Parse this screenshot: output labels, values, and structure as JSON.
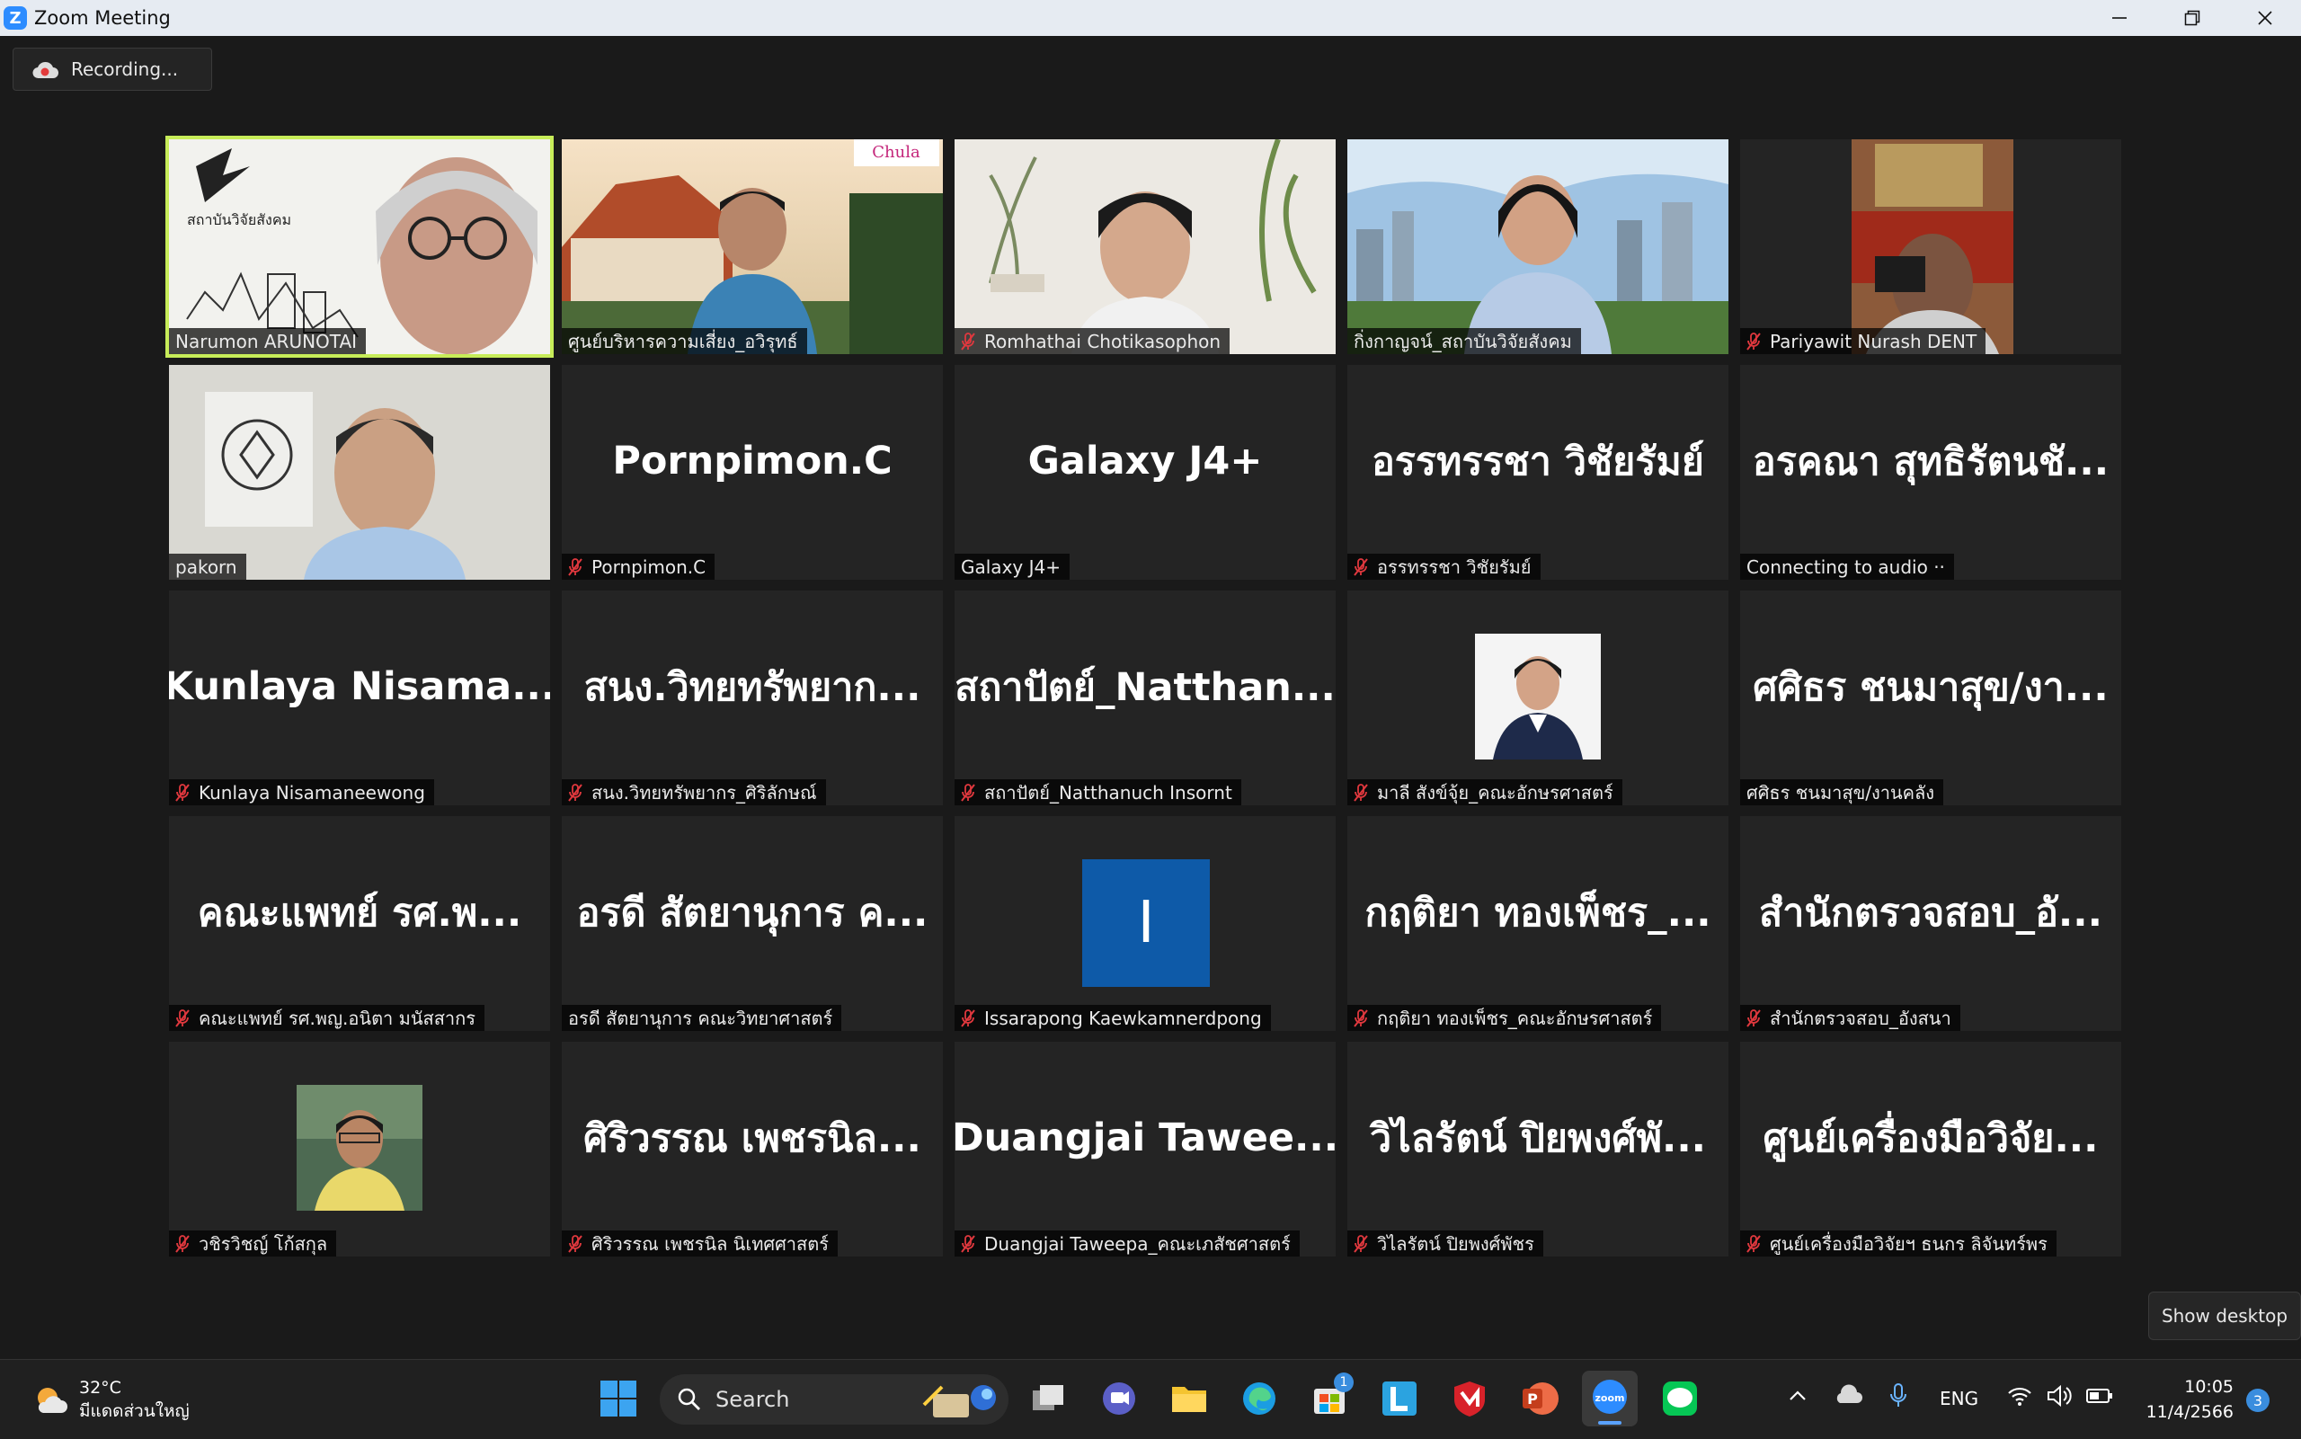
{
  "window": {
    "title": "Zoom Meeting"
  },
  "recording": {
    "label": "Recording..."
  },
  "show_desktop": "Show desktop",
  "participants": [
    {
      "big": "",
      "name": "Narumon ARUNOTAI",
      "muted": false,
      "video": "narumon",
      "active": true
    },
    {
      "big": "",
      "name": "ศูนย์บริหารความเสี่ยง_อวิรุทธ์",
      "muted": false,
      "video": "campus"
    },
    {
      "big": "",
      "name": "Romhathai Chotikasophon",
      "muted": true,
      "video": "room"
    },
    {
      "big": "",
      "name": "กิ่งกาญจน์_สถาบันวิจัยสังคม",
      "muted": false,
      "video": "city"
    },
    {
      "big": "",
      "name": "Pariyawit Nurash DENT",
      "muted": true,
      "video": "pariyawit"
    },
    {
      "big": "",
      "name": "pakorn",
      "muted": false,
      "video": "pakorn"
    },
    {
      "big": "Pornpimon.C",
      "name": "Pornpimon.C",
      "muted": true
    },
    {
      "big": "Galaxy J4+",
      "name": "Galaxy J4+",
      "muted": false
    },
    {
      "big": "อรรทรรชา วิชัยรัมย์",
      "name": "อรรทรรชา วิชัยรัมย์",
      "muted": true
    },
    {
      "big": "อรคณา สุทธิรัตนชั...",
      "name": "Connecting to audio ··",
      "muted": false
    },
    {
      "big": "Kunlaya Nisama...",
      "name": "Kunlaya Nisamaneewong",
      "muted": true
    },
    {
      "big": "สนง.วิทยทรัพยาก...",
      "name": "สนง.วิทยทรัพยากร_ศิริลักษณ์",
      "muted": true
    },
    {
      "big": "สถาปัตย์_Natthan...",
      "name": "สถาปัตย์_Natthanuch Insornt",
      "muted": true
    },
    {
      "big": "",
      "name": "มาลี สังข์จุ้ย_คณะอักษรศาสตร์",
      "muted": true,
      "video": "mali"
    },
    {
      "big": "ศศิธร ชนมาสุข/งา...",
      "name": "ศศิธร ชนมาสุข/งานคลัง",
      "muted": false
    },
    {
      "big": "คณะแพทย์ รศ.พ...",
      "name": "คณะแพทย์ รศ.พญ.อนิตา มนัสสากร",
      "muted": true
    },
    {
      "big": "อรดี สัตยานุการ ค...",
      "name": "อรดี สัตยานุการ คณะวิทยาศาสตร์",
      "muted": false
    },
    {
      "big": "",
      "name": "Issarapong Kaewkamnerdpong",
      "muted": true,
      "initial": "I"
    },
    {
      "big": "กฤติยา ทองเพ็ชร_...",
      "name": "กฤติยา ทองเพ็ชร_คณะอักษรศาสตร์",
      "muted": true
    },
    {
      "big": "สำนักตรวจสอบ_อั...",
      "name": "สำนักตรวจสอบ_อังสนา",
      "muted": true
    },
    {
      "big": "",
      "name": "วชิรวิชญ์ โก้สกุล",
      "muted": true,
      "video": "wachira"
    },
    {
      "big": "ศิริวรรณ เพชรนิล...",
      "name": "ศิริวรรณ เพชรนิล นิเทศศาสตร์",
      "muted": true
    },
    {
      "big": "Duangjai Tawee...",
      "name": "Duangjai Taweepa_คณะเภสัชศาสตร์",
      "muted": true
    },
    {
      "big": "วิไลรัตน์ ปิยพงศ์พั...",
      "name": "วิไลรัตน์ ปิยพงศ์พัชร",
      "muted": true
    },
    {
      "big": "ศูนย์เครื่องมือวิจัย...",
      "name": "ศูนย์เครื่องมือวิจัยฯ ธนกร ลิจันทร์พร",
      "muted": true
    }
  ],
  "taskbar": {
    "weather_temp": "32°C",
    "weather_desc": "มีแดดส่วนใหญ่",
    "search_label": "Search",
    "store_badge": "1",
    "lang": "ENG",
    "time": "10:05",
    "date": "11/4/2566",
    "notif_count": "3"
  }
}
